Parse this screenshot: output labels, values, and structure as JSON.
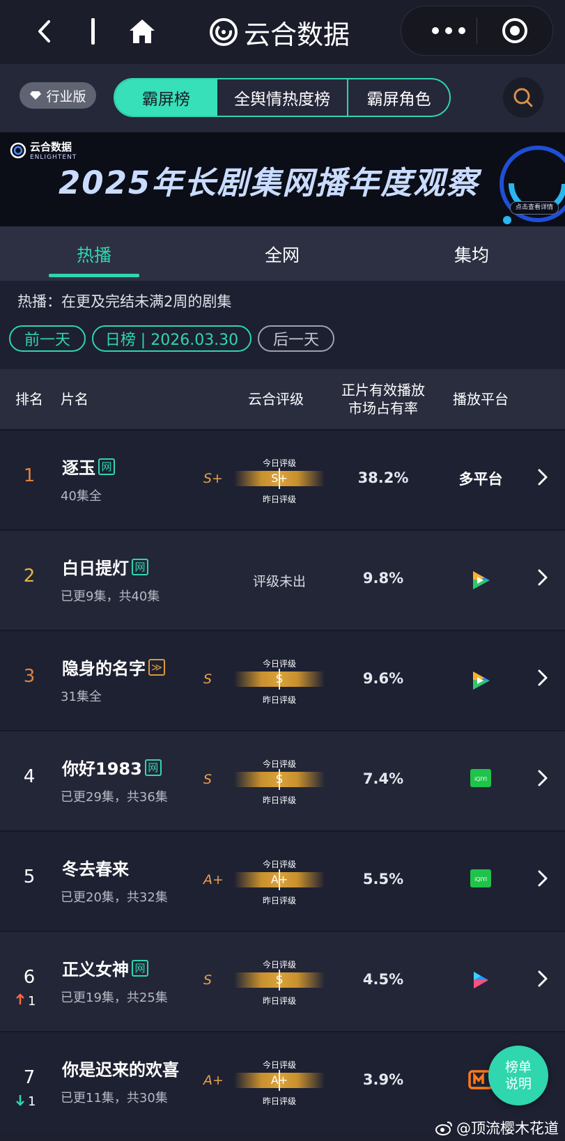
{
  "app": {
    "title": "云合数据"
  },
  "nav": {
    "industry_label": "行业版",
    "tabs": [
      "霸屏榜",
      "全舆情热度榜",
      "霸屏角色"
    ],
    "active_tab": 0
  },
  "banner": {
    "logo_cn": "云合数据",
    "logo_en": "ENLIGHTENT",
    "title": "2025年长剧集网播年度观察",
    "button": "点击查看详情"
  },
  "subtabs": [
    "热播",
    "全网",
    "集均"
  ],
  "filter": {
    "note": "热播：在更及完结未满2周的剧集",
    "prev_label": "前一天",
    "date_label": "日榜 | 2026.03.30",
    "next_label": "后一天"
  },
  "table": {
    "headers": {
      "rank": "排名",
      "name": "片名",
      "grade": "云合评级",
      "share_line1": "正片有效播放",
      "share_line2": "市场占有率",
      "platform": "播放平台"
    },
    "grade_today_label": "今日评级",
    "grade_yesterday_label": "昨日评级",
    "rows": [
      {
        "rank": "1",
        "rank_color": "#e0823f",
        "name": "逐玉",
        "tag": "网",
        "tag_type": "net",
        "episodes": "40集全",
        "grade": "S+",
        "share": "38.2%",
        "platform_text": "多平台",
        "platform_icon": "",
        "trend": "",
        "trend_dir": ""
      },
      {
        "rank": "2",
        "rank_color": "#e8b43c",
        "name": "白日提灯",
        "tag": "网",
        "tag_type": "net",
        "episodes": "已更9集，共40集",
        "grade": "",
        "grade_none": "评级未出",
        "share": "9.8%",
        "platform_text": "",
        "platform_icon": "tencent-video-icon",
        "trend": "",
        "trend_dir": ""
      },
      {
        "rank": "3",
        "rank_color": "#e0823f",
        "name": "隐身的名字",
        "tag": "≫",
        "tag_type": "gold",
        "episodes": "31集全",
        "grade": "S",
        "share": "9.6%",
        "platform_text": "",
        "platform_icon": "tencent-video-icon",
        "trend": "",
        "trend_dir": ""
      },
      {
        "rank": "4",
        "rank_color": "#ffffff",
        "name": "你好1983",
        "tag": "网",
        "tag_type": "net",
        "episodes": "已更29集，共36集",
        "grade": "S",
        "share": "7.4%",
        "platform_text": "",
        "platform_icon": "iqiyi-icon",
        "trend": "",
        "trend_dir": ""
      },
      {
        "rank": "5",
        "rank_color": "#ffffff",
        "name": "冬去春来",
        "tag": "",
        "tag_type": "",
        "episodes": "已更20集，共32集",
        "grade": "A+",
        "share": "5.5%",
        "platform_text": "",
        "platform_icon": "iqiyi-icon",
        "trend": "",
        "trend_dir": ""
      },
      {
        "rank": "6",
        "rank_color": "#ffffff",
        "name": "正义女神",
        "tag": "网",
        "tag_type": "net",
        "episodes": "已更19集，共25集",
        "grade": "S",
        "share": "4.5%",
        "platform_text": "",
        "platform_icon": "youku-icon",
        "trend": "1",
        "trend_dir": "up"
      },
      {
        "rank": "7",
        "rank_color": "#ffffff",
        "name": "你是迟来的欢喜",
        "tag": "",
        "tag_type": "",
        "episodes": "已更11集，共30集",
        "grade": "A+",
        "share": "3.9%",
        "platform_text": "",
        "platform_icon": "mango-tv-icon",
        "trend": "1",
        "trend_dir": "down"
      }
    ]
  },
  "fab": {
    "line1": "榜单",
    "line2": "说明"
  },
  "watermark": "@顶流樱木花道",
  "colors": {
    "accent": "#2fd6ae",
    "grade_gold": "#d9a23a",
    "grade_letter": "#e8a14a",
    "trend_up": "#ff6a3d",
    "trend_down": "#2fd6ae"
  }
}
